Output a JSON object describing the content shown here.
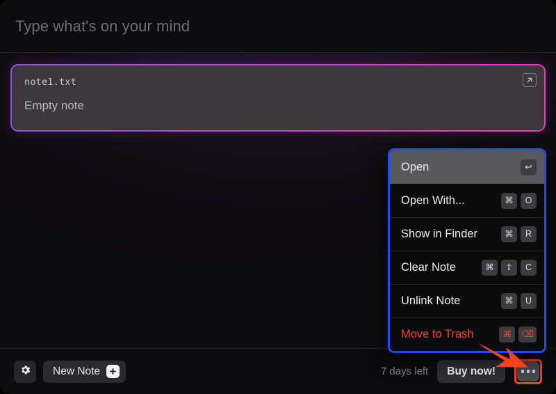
{
  "app": {
    "accent_purple": "#9052e0",
    "accent_magenta": "#f62ec6",
    "menu_highlight_border": "#1f4cf0",
    "annotation_color": "#f2421f",
    "danger_color": "#f2422f",
    "background": "#0d0c0f"
  },
  "header": {
    "placeholder": "Type what's on your mind"
  },
  "note_card": {
    "filename": "note1.txt",
    "body_text": "Empty note",
    "expand_icon": "arrow-up-right-icon"
  },
  "context_menu": {
    "items": [
      {
        "label": "Open",
        "keys": [
          "↩"
        ],
        "highlighted": true,
        "danger": false
      },
      {
        "label": "Open With...",
        "keys": [
          "⌘",
          "O"
        ],
        "highlighted": false,
        "danger": false
      },
      {
        "label": "Show in Finder",
        "keys": [
          "⌘",
          "R"
        ],
        "highlighted": false,
        "danger": false
      },
      {
        "label": "Clear Note",
        "keys": [
          "⌘",
          "⇧",
          "C"
        ],
        "highlighted": false,
        "danger": false
      },
      {
        "label": "Unlink Note",
        "keys": [
          "⌘",
          "U"
        ],
        "highlighted": false,
        "danger": false
      },
      {
        "label": "Move to Trash",
        "keys": [
          "⌘",
          "⌫"
        ],
        "highlighted": false,
        "danger": true
      }
    ]
  },
  "footer": {
    "settings_icon": "gear-icon",
    "new_note_label": "New Note",
    "new_note_icon": "plus-icon",
    "trial_text": "7 days left",
    "buy_now_label": "Buy now!",
    "more_icon": "ellipsis-icon"
  }
}
